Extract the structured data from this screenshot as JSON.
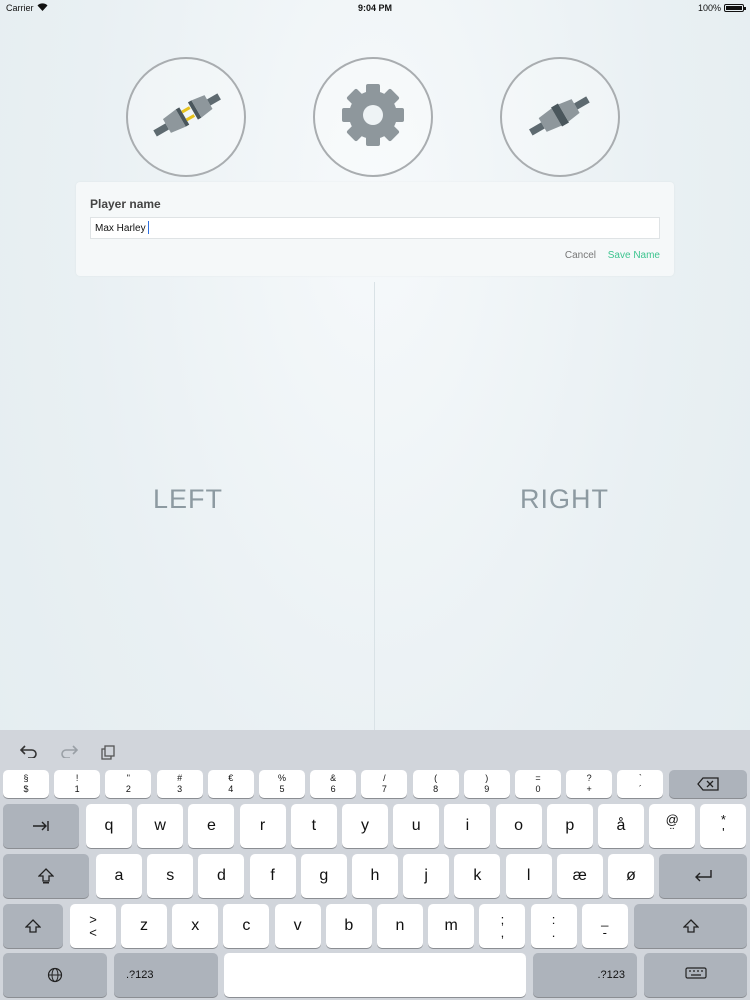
{
  "status_bar": {
    "carrier": "Carrier",
    "time": "9:04 PM",
    "battery": "100%"
  },
  "top_buttons": [
    {
      "name": "connect",
      "icon": "plug-connect-icon"
    },
    {
      "name": "settings",
      "icon": "gear-icon"
    },
    {
      "name": "disconnect",
      "icon": "plug-disconnect-icon"
    }
  ],
  "player_dialog": {
    "title": "Player name",
    "value": "Max Harley",
    "cancel_label": "Cancel",
    "save_label": "Save Name"
  },
  "halves": {
    "left_label": "LEFT",
    "right_label": "RIGHT"
  },
  "keyboard": {
    "toolbar": [
      "undo-icon",
      "redo-icon",
      "paste-icon"
    ],
    "number_row": [
      {
        "top": "§",
        "bottom": "$"
      },
      {
        "top": "!",
        "bottom": "1"
      },
      {
        "top": "\"",
        "bottom": "2"
      },
      {
        "top": "#",
        "bottom": "3"
      },
      {
        "top": "€",
        "bottom": "4"
      },
      {
        "top": "%",
        "bottom": "5"
      },
      {
        "top": "&",
        "bottom": "6"
      },
      {
        "top": "/",
        "bottom": "7"
      },
      {
        "top": "(",
        "bottom": "8"
      },
      {
        "top": ")",
        "bottom": "9"
      },
      {
        "top": "=",
        "bottom": "0"
      },
      {
        "top": "?",
        "bottom": "+"
      },
      {
        "top": "`",
        "bottom": "´"
      }
    ],
    "row1": [
      "q",
      "w",
      "e",
      "r",
      "t",
      "y",
      "u",
      "i",
      "o",
      "p",
      "å"
    ],
    "row1_extra": [
      {
        "top": "@",
        "bottom": "¨"
      },
      {
        "top": "*",
        "bottom": "'"
      }
    ],
    "row2": [
      "a",
      "s",
      "d",
      "f",
      "g",
      "h",
      "j",
      "k",
      "l",
      "æ",
      "ø"
    ],
    "row3_first": {
      "top": ">",
      "bottom": "<"
    },
    "row3": [
      "z",
      "x",
      "c",
      "v",
      "b",
      "n",
      "m"
    ],
    "row3_extra": [
      {
        "top": ";",
        "bottom": ","
      },
      {
        "top": ":",
        "bottom": "."
      },
      {
        "top": "_",
        "bottom": "-"
      }
    ],
    "numbers_label": ".?123"
  },
  "colors": {
    "accent": "#3dc48f",
    "keyboard_bg": "#d1d5db",
    "label": "#8d9aa1"
  }
}
